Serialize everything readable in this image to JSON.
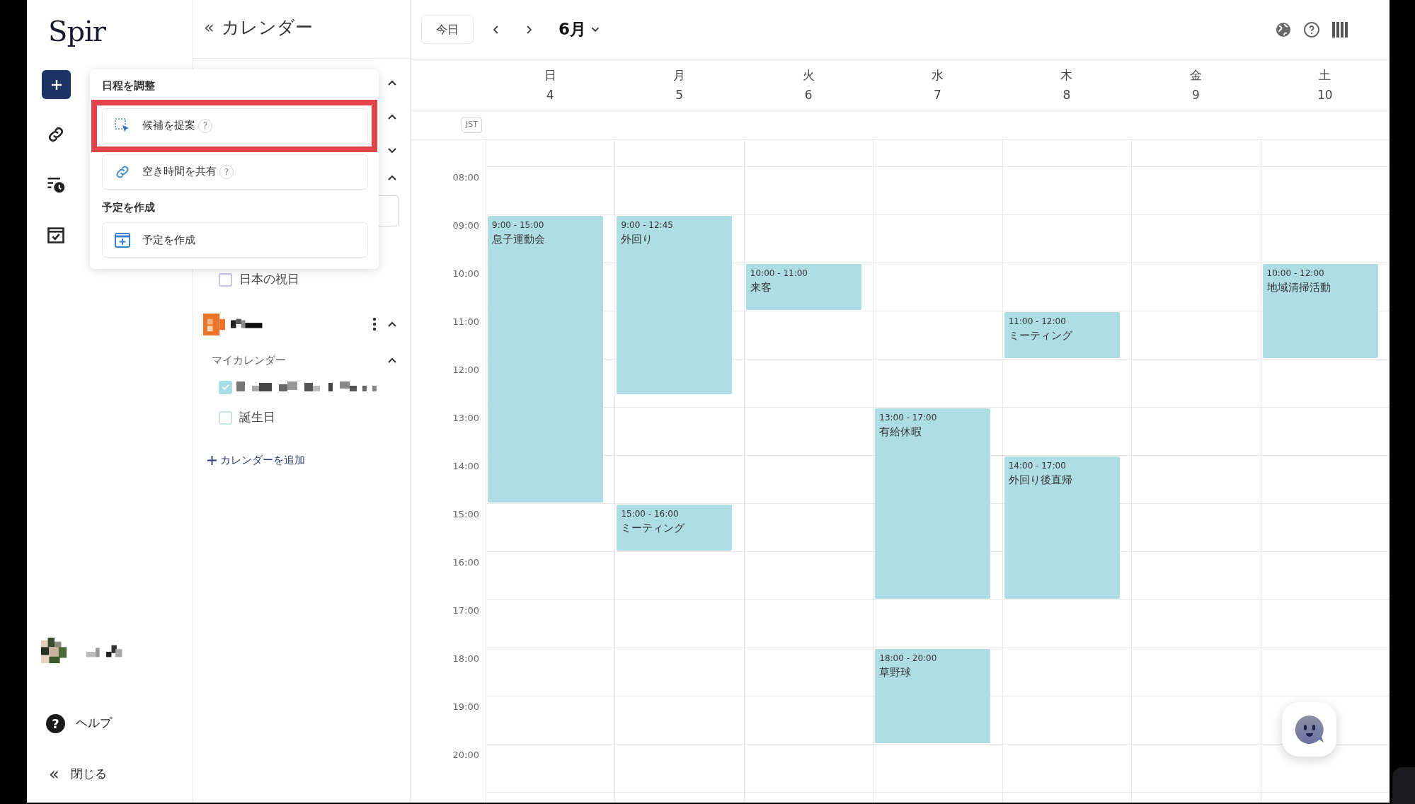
{
  "sidebar": {
    "logo": "Spir",
    "bottom": [
      {
        "kind": "user"
      },
      {
        "kind": "help",
        "icon": "?",
        "label": "ヘルプ"
      },
      {
        "kind": "close",
        "icon": "«",
        "label": "閉じる"
      }
    ]
  },
  "calendar_panel": {
    "collapse": "«",
    "title": "カレンダー",
    "holiday": {
      "label": "日本の祝日",
      "checked": false
    },
    "account": {
      "section": "マイカレンダー",
      "calendars": [
        {
          "checked": true,
          "kind": "redacted"
        },
        {
          "label": "誕生日",
          "checked": false,
          "kind": "text"
        }
      ]
    },
    "add_link": "カレンダーを追加"
  },
  "popup": {
    "sections": [
      {
        "title": "日程を調整",
        "items": [
          {
            "label": "候補を提案",
            "kind": "select",
            "help": "?",
            "highlighted": true
          },
          {
            "label": "空き時間を共有",
            "kind": "link",
            "help": "?",
            "highlighted": false
          }
        ]
      },
      {
        "title": "予定を作成",
        "items": [
          {
            "label": "予定を作成",
            "kind": "add",
            "highlighted": false
          }
        ]
      }
    ]
  },
  "toolbar": {
    "today": "今日",
    "month": "6月"
  },
  "timezone": "JST",
  "hours": [
    "08:00",
    "09:00",
    "10:00",
    "11:00",
    "12:00",
    "13:00",
    "14:00",
    "15:00",
    "16:00",
    "17:00",
    "18:00",
    "19:00",
    "20:00"
  ],
  "days": [
    {
      "name": "日",
      "date": "4",
      "events": [
        {
          "time": "9:00 - 15:00",
          "title": "息子運動会"
        }
      ]
    },
    {
      "name": "月",
      "date": "5",
      "events": [
        {
          "time": "9:00 - 12:45",
          "title": "外回り"
        },
        {
          "time": "15:00 - 16:00",
          "title": "ミーティング"
        }
      ]
    },
    {
      "name": "火",
      "date": "6",
      "events": [
        {
          "time": "10:00 - 11:00",
          "title": "来客"
        }
      ]
    },
    {
      "name": "水",
      "date": "7",
      "events": [
        {
          "time": "13:00 - 17:00",
          "title": "有給休暇"
        },
        {
          "time": "18:00 - 20:00",
          "title": "草野球"
        }
      ]
    },
    {
      "name": "木",
      "date": "8",
      "events": [
        {
          "time": "11:00 - 12:00",
          "title": "ミーティング"
        },
        {
          "time": "14:00 - 17:00",
          "title": "外回り後直帰"
        }
      ]
    },
    {
      "name": "金",
      "date": "9"
    },
    {
      "name": "土",
      "date": "10",
      "events": [
        {
          "time": "10:00 - 12:00",
          "title": "地域清掃活動"
        }
      ]
    }
  ]
}
